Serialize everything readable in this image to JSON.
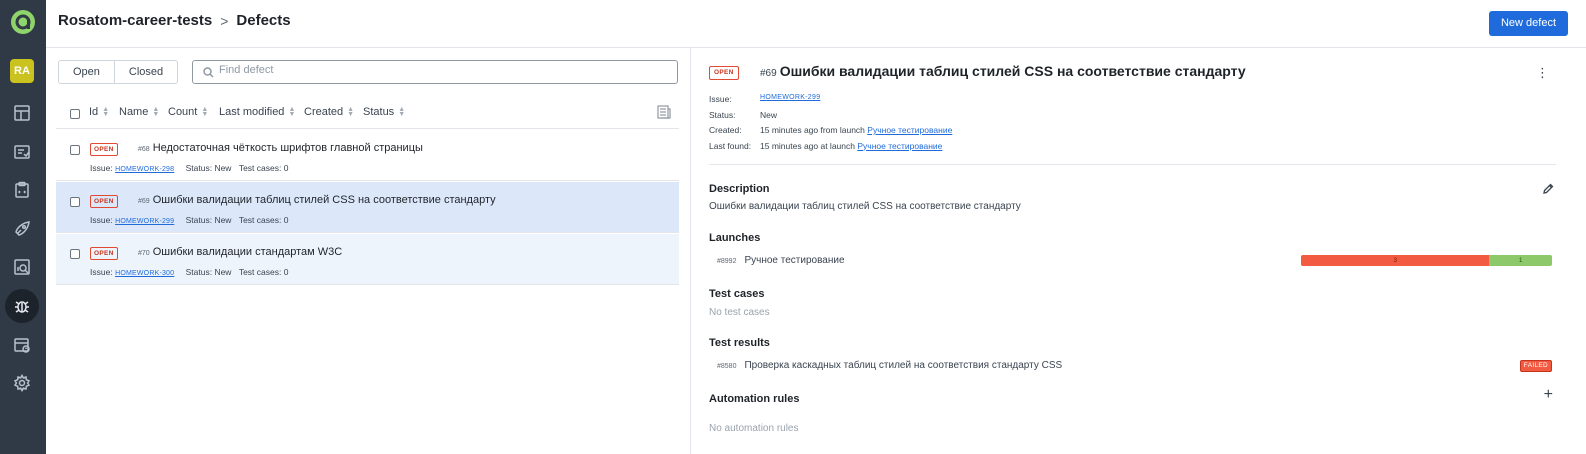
{
  "sidebar": {
    "avatar": "RA",
    "items": [
      {
        "icon": "dashboard-icon"
      },
      {
        "icon": "launches-icon"
      },
      {
        "icon": "test-cases-icon"
      },
      {
        "icon": "jobs-icon"
      },
      {
        "icon": "analytics-icon"
      },
      {
        "icon": "defects-icon",
        "active": true
      },
      {
        "icon": "storage-icon"
      },
      {
        "icon": "settings-icon"
      }
    ]
  },
  "header": {
    "project": "Rosatom-career-tests",
    "separator": ">",
    "page": "Defects",
    "new_button": "New defect"
  },
  "filter": {
    "open": "Open",
    "closed": "Closed",
    "search_placeholder": "Find defect"
  },
  "table": {
    "columns": [
      "Id",
      "Name",
      "Count",
      "Last modified",
      "Created",
      "Status"
    ],
    "rows": [
      {
        "badge": "OPEN",
        "num": "#68",
        "title": "Недостаточная чёткость шрифтов главной страницы",
        "issue_label": "Issue:",
        "issue": "HOMEWORK-298",
        "status": "Status: New",
        "tests": "Test cases: 0"
      },
      {
        "badge": "OPEN",
        "num": "#69",
        "title": "Ошибки валидации таблиц стилей CSS на соответствие стандарту",
        "issue_label": "Issue:",
        "issue": "HOMEWORK-299",
        "status": "Status: New",
        "tests": "Test cases: 0"
      },
      {
        "badge": "OPEN",
        "num": "#70",
        "title": "Ошибки валидации стандартам W3C",
        "issue_label": "Issue:",
        "issue": "HOMEWORK-300",
        "status": "Status: New",
        "tests": "Test cases: 0"
      }
    ]
  },
  "detail": {
    "badge": "OPEN",
    "num": "#69",
    "title": "Ошибки валидации таблиц стилей CSS на соответствие стандарту",
    "props": {
      "issue_k": "Issue:",
      "issue_v": "HOMEWORK-299",
      "status_k": "Status:",
      "status_v": "New",
      "created_k": "Created:",
      "created_v": "15 minutes ago from launch",
      "created_link": "Ручное тестирование",
      "found_k": "Last found:",
      "found_v": "15 minutes ago at launch",
      "found_link": "Ручное тестирование"
    },
    "description_title": "Description",
    "description": "Ошибки валидации таблиц стилей CSS на соответствие стандарту",
    "launches_title": "Launches",
    "launch": {
      "num": "#8992",
      "name": "Ручное тестирование",
      "failed": 3,
      "passed": 1
    },
    "test_cases_title": "Test cases",
    "test_cases_empty": "No test cases",
    "test_results_title": "Test results",
    "test_result": {
      "num": "#8580",
      "name": "Проверка каскадных таблиц стилей на соответствия стандарту CSS",
      "status": "FAILED"
    },
    "automation_title": "Automation rules",
    "automation_empty": "No automation rules"
  },
  "colors": {
    "accent": "#1f6bdb",
    "sidebar": "#2f3a46",
    "failed": "#f25b42",
    "passed": "#8dc96b"
  }
}
